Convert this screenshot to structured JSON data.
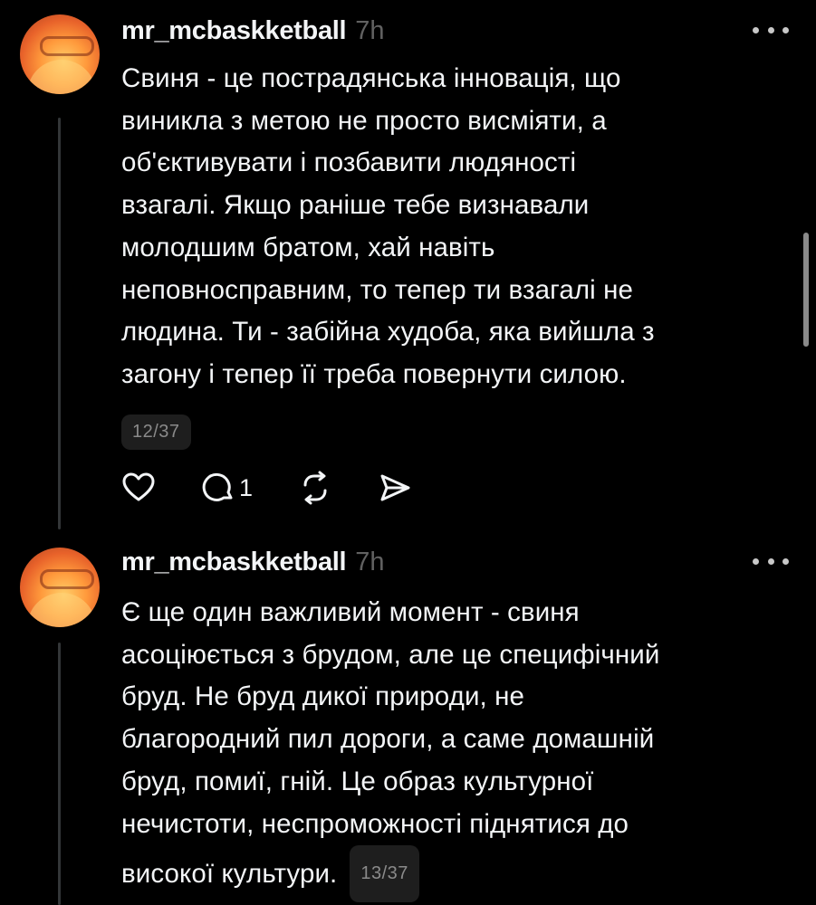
{
  "posts": [
    {
      "username": "mr_mcbaskketball",
      "time": "7h",
      "text": "Свиня - це пострадянська інновація, що\nвиникла з метою не просто висміяти, а\nоб'єктивувати і позбавити людяності\nвзагалі. Якщо раніше тебе визнавали\nмолодшим братом, хай навіть\nнеповносправним, то тепер ти взагалі не\nлюдина. Ти - забійна худоба, яка вийшла з\nзагону і тепер її треба повернути силою.",
      "counter": "12/37",
      "reply_count": "1"
    },
    {
      "username": "mr_mcbaskketball",
      "time": "7h",
      "text": "Є ще один важливий момент - свиня\nасоціюється з брудом, але це специфічний\nбруд. Не бруд дикої природи, не\nблагородний пил дороги, а саме домашній\nбруд, помиї, гній. Це образ культурної\nнечистоти, неспроможності піднятися до\nвисокої культури.",
      "counter": "13/37"
    }
  ],
  "icons": {
    "like": "heart-icon",
    "reply": "comment-icon",
    "repost": "repost-icon",
    "share": "send-icon",
    "more": "more-icon"
  },
  "colors": {
    "background": "#000000",
    "text": "#f3f5f7",
    "muted": "#616161",
    "thread_line": "#333638"
  }
}
